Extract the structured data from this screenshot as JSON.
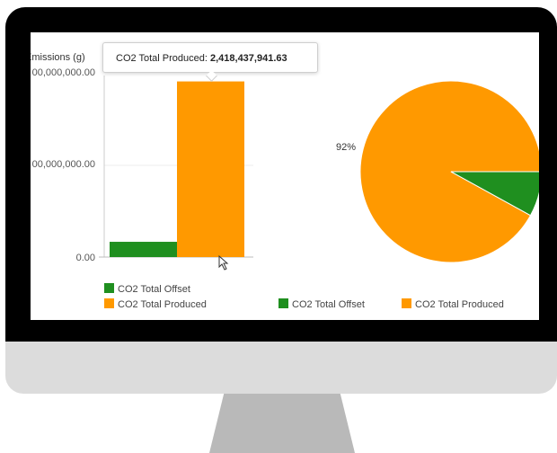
{
  "colors": {
    "offset": "#1f8f1f",
    "produced": "#ff9900",
    "bezel": "#000000",
    "chin": "#dcdcdc",
    "stand": "#b9b9b9"
  },
  "bar_chart": {
    "axis_title": "Emissions (g)",
    "ticks": [
      "00,000,000.00",
      "00,000,000.00",
      "0.00"
    ],
    "tooltip": {
      "label": "CO2 Total Produced:",
      "value": "2,418,437,941.63"
    },
    "legend": [
      "CO2 Total Offset",
      "CO2 Total Produced"
    ]
  },
  "pie_chart": {
    "slice_label": "92%",
    "legend": [
      "CO2 Total Offset",
      "CO2 Total Produced"
    ]
  },
  "chart_data": [
    {
      "type": "bar",
      "categories": [
        "CO2 Total Offset",
        "CO2 Total Produced"
      ],
      "values": [
        210000000,
        2418437941.63
      ],
      "ylim": [
        0,
        2500000000
      ],
      "ylabel": "Emissions (g)",
      "grid": true,
      "legend_placement": "bottom-left"
    },
    {
      "type": "pie",
      "categories": [
        "CO2 Total Offset",
        "CO2 Total Produced"
      ],
      "values": [
        8,
        92
      ],
      "legend_placement": "bottom"
    }
  ]
}
